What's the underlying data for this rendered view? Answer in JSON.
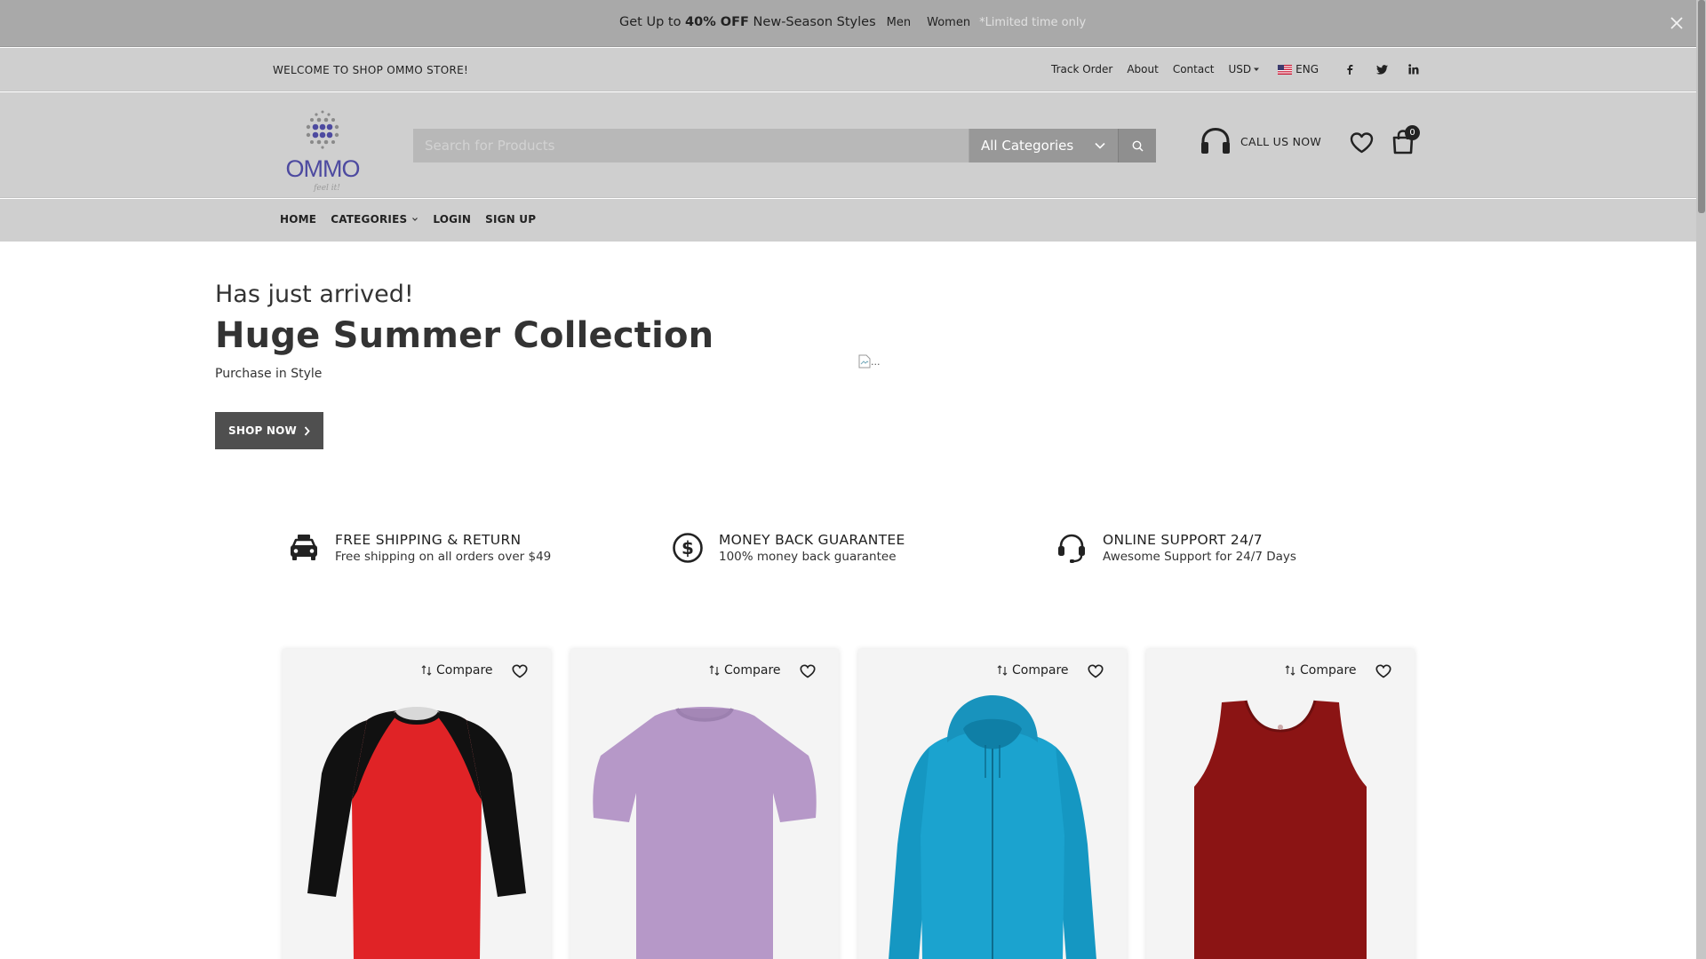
{
  "promo": {
    "prefix": "Get Up to ",
    "highlight": "40% OFF",
    "suffix": " New-Season Styles",
    "link_men": "Men",
    "link_women": "Women",
    "note": "*Limited time only"
  },
  "topbar": {
    "welcome": "WELCOME TO SHOP OMMO STORE!",
    "track_order": "Track Order",
    "about": "About",
    "contact": "Contact",
    "currency": "USD",
    "language": "ENG"
  },
  "header": {
    "logo_text": "OMMO",
    "logo_tagline": "feel it!",
    "search_placeholder": "Search for Products",
    "category_selected": "All Categories",
    "call_label": "CALL US NOW",
    "cart_count": "0"
  },
  "nav": {
    "home": "HOME",
    "categories": "CATEGORIES",
    "login": "LOGIN",
    "signup": "SIGN UP"
  },
  "hero": {
    "subtitle": "Has just arrived!",
    "title": "Huge Summer Collection",
    "tagline": "Purchase in Style",
    "button": "SHOP NOW",
    "image_alt": "..."
  },
  "features": [
    {
      "title": "FREE SHIPPING & RETURN",
      "desc": "Free shipping on all orders over $49",
      "icon": "truck-icon"
    },
    {
      "title": "MONEY BACK GUARANTEE",
      "desc": "100% money back guarantee",
      "icon": "dollar-icon"
    },
    {
      "title": "ONLINE SUPPORT 24/7",
      "desc": "Awesome Support for 24/7 Days",
      "icon": "headset-icon"
    }
  ],
  "products": [
    {
      "compare": "Compare",
      "color": "#e02326",
      "sleeve": "#111111",
      "type": "raglan"
    },
    {
      "compare": "Compare",
      "color": "#b698c8",
      "type": "tee"
    },
    {
      "compare": "Compare",
      "color": "#1ba3cf",
      "type": "hoodie"
    },
    {
      "compare": "Compare",
      "color": "#8b1414",
      "type": "tank"
    }
  ]
}
